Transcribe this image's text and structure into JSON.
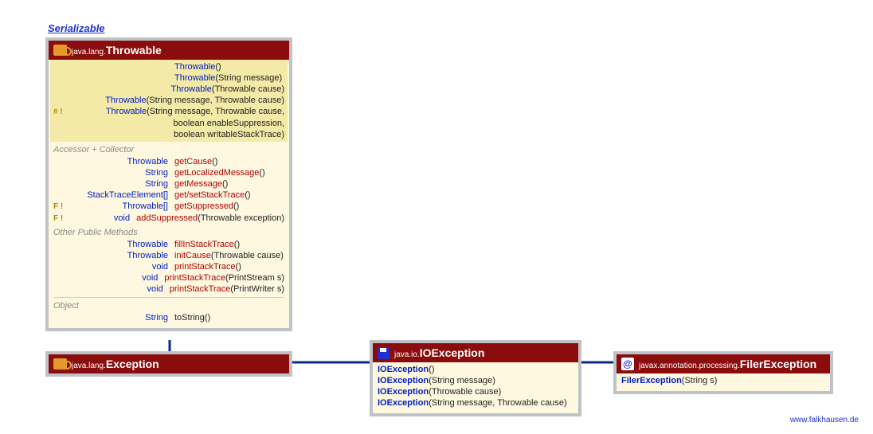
{
  "interface_label": "Serializable",
  "footer": "www.falkhausen.de",
  "throwable": {
    "pkg": "java.lang.",
    "cls": "Throwable",
    "ctors": [
      {
        "g": "",
        "name": "Throwable",
        "args": "()"
      },
      {
        "g": "",
        "name": "Throwable",
        "args": "(String message)"
      },
      {
        "g": "",
        "name": "Throwable",
        "args": "(Throwable cause)"
      },
      {
        "g": "",
        "name": "Throwable",
        "args": "(String message, Throwable cause)"
      },
      {
        "g": "# !",
        "name": "Throwable",
        "args": "(String message, Throwable cause,"
      },
      {
        "cont": "boolean enableSuppression,"
      },
      {
        "cont": "boolean writableStackTrace)"
      }
    ],
    "sect_accessor": "Accessor + Collector",
    "accessors": [
      {
        "g": "",
        "ret": "Throwable",
        "name": "getCause",
        "args": "()"
      },
      {
        "g": "",
        "ret": "String",
        "name": "getLocalizedMessage",
        "args": "()"
      },
      {
        "g": "",
        "ret": "String",
        "name": "getMessage",
        "args": "()"
      },
      {
        "g": "",
        "ret": "StackTraceElement[]",
        "name": "get/setStackTrace",
        "args": "()"
      },
      {
        "g": "F !",
        "ret": "Throwable[]",
        "name": "getSuppressed",
        "args": "()"
      },
      {
        "g": "F !",
        "ret": "void",
        "name": "addSuppressed",
        "args": "(Throwable exception)"
      }
    ],
    "sect_public": "Other Public Methods",
    "publics": [
      {
        "ret": "Throwable",
        "name": "fillInStackTrace",
        "args": "()"
      },
      {
        "ret": "Throwable",
        "name": "initCause",
        "args": "(Throwable cause)"
      },
      {
        "ret": "void",
        "name": "printStackTrace",
        "args": "()"
      },
      {
        "ret": "void",
        "name": "printStackTrace",
        "args": "(PrintStream s)"
      },
      {
        "ret": "void",
        "name": "printStackTrace",
        "args": "(PrintWriter s)"
      }
    ],
    "sect_object": "Object",
    "objects": [
      {
        "ret": "String",
        "name": "toString",
        "args": "()"
      }
    ]
  },
  "exception": {
    "pkg": "java.lang.",
    "cls": "Exception"
  },
  "ioexception": {
    "pkg": "java.io.",
    "cls": "IOException",
    "ctors": [
      {
        "name": "IOException",
        "args": "()"
      },
      {
        "name": "IOException",
        "args": "(String message)"
      },
      {
        "name": "IOException",
        "args": "(Throwable cause)"
      },
      {
        "name": "IOException",
        "args": "(String message, Throwable cause)"
      }
    ]
  },
  "filer": {
    "pkg": "javax.annotation.processing.",
    "cls": "FilerException",
    "ctors": [
      {
        "name": "FilerException",
        "args": "(String s)"
      }
    ]
  }
}
